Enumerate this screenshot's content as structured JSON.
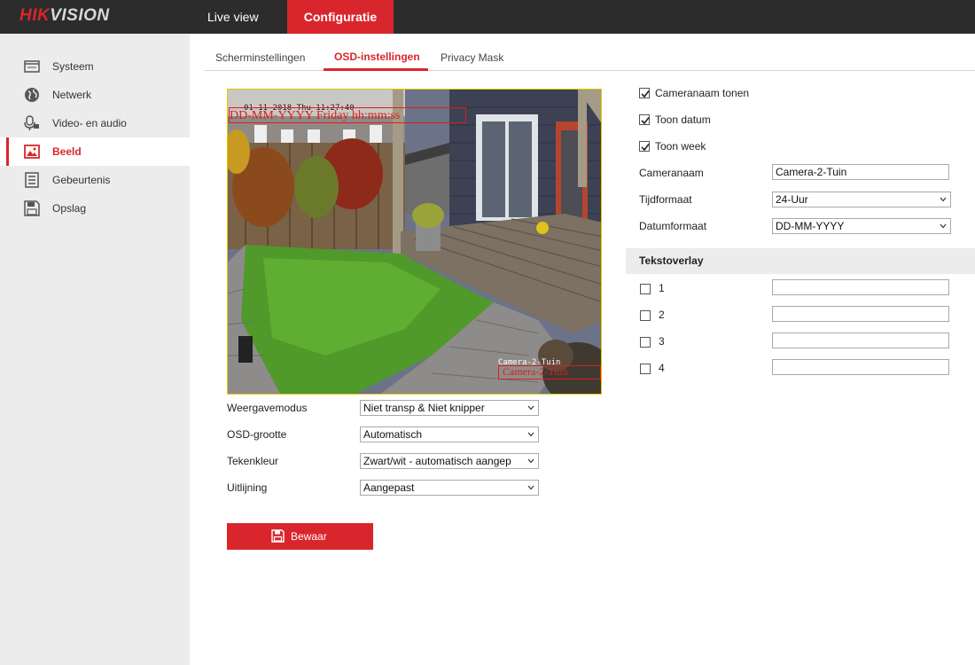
{
  "header": {
    "logo_hik": "HIK",
    "logo_vision": "VISION",
    "tabs": [
      {
        "label": "Live view"
      },
      {
        "label": "Configuratie"
      }
    ]
  },
  "sidebar": {
    "items": [
      {
        "label": "Systeem",
        "icon": "monitor-icon"
      },
      {
        "label": "Netwerk",
        "icon": "globe-icon"
      },
      {
        "label": "Video- en audio",
        "icon": "microphone-icon"
      },
      {
        "label": "Beeld",
        "icon": "image-icon"
      },
      {
        "label": "Gebeurtenis",
        "icon": "list-icon"
      },
      {
        "label": "Opslag",
        "icon": "disk-icon"
      }
    ]
  },
  "subtabs": [
    {
      "label": "Scherminstellingen"
    },
    {
      "label": "OSD-instellingen"
    },
    {
      "label": "Privacy Mask"
    }
  ],
  "preview": {
    "osd_time": "01-11-2018 Thu 11:27:40",
    "osd_date_format": "DD-MM-YYYY Friday hh:mm:ss",
    "osd_camera_small": "Camera-2-Tuin",
    "osd_camera_red": "Camera-2-Tuin"
  },
  "left_form": {
    "weergavemodus": {
      "label": "Weergavemodus",
      "value": "Niet transp & Niet knipper"
    },
    "osd_grootte": {
      "label": "OSD-grootte",
      "value": "Automatisch"
    },
    "tekenkleur": {
      "label": "Tekenkleur",
      "value": "Zwart/wit - automatisch aangep"
    },
    "uitlijning": {
      "label": "Uitlijning",
      "value": "Aangepast"
    }
  },
  "save_label": "Bewaar",
  "right_form": {
    "checks": [
      {
        "label": "Cameranaam tonen",
        "checked": true
      },
      {
        "label": "Toon datum",
        "checked": true
      },
      {
        "label": "Toon week",
        "checked": true
      }
    ],
    "cameranaam": {
      "label": "Cameranaam",
      "value": "Camera-2-Tuin"
    },
    "tijdformaat": {
      "label": "Tijdformaat",
      "value": "24-Uur"
    },
    "datumformaat": {
      "label": "Datumformaat",
      "value": "DD-MM-YYYY"
    }
  },
  "overlay": {
    "title": "Tekstoverlay",
    "rows": [
      {
        "label": "1",
        "value": ""
      },
      {
        "label": "2",
        "value": ""
      },
      {
        "label": "3",
        "value": ""
      },
      {
        "label": "4",
        "value": ""
      }
    ]
  },
  "colors": {
    "accent": "#d9262c",
    "topbar": "#2c2c2c",
    "sidebar": "#ececec"
  }
}
